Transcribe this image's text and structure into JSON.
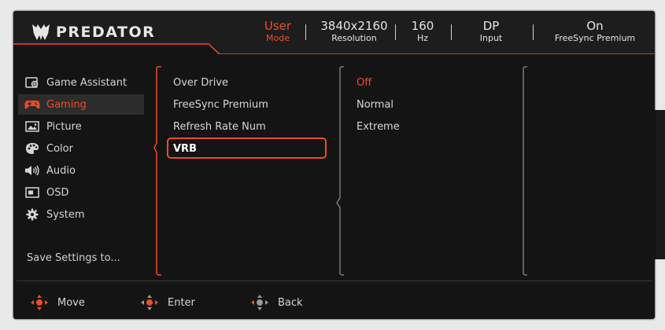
{
  "brand": {
    "name": "PREDATOR"
  },
  "status_bar": [
    {
      "value": "User",
      "label": "Mode"
    },
    {
      "value": "3840x2160",
      "label": "Resolution"
    },
    {
      "value": "160",
      "label": "Hz"
    },
    {
      "value": "DP",
      "label": "Input"
    },
    {
      "value": "On",
      "label": "FreeSync Premium"
    }
  ],
  "menu": {
    "items": [
      {
        "label": "Game Assistant",
        "icon": "game-assistant-icon"
      },
      {
        "label": "Gaming",
        "icon": "gamepad-icon",
        "active": true
      },
      {
        "label": "Picture",
        "icon": "picture-icon"
      },
      {
        "label": "Color",
        "icon": "palette-icon"
      },
      {
        "label": "Audio",
        "icon": "speaker-icon"
      },
      {
        "label": "OSD",
        "icon": "osd-icon"
      },
      {
        "label": "System",
        "icon": "gear-icon"
      }
    ],
    "save_label": "Save Settings to..."
  },
  "gaming_options": {
    "items": [
      "Over Drive",
      "FreeSync Premium",
      "Refresh Rate Num",
      "VRB"
    ],
    "selected": "VRB"
  },
  "values": {
    "items": [
      "Off",
      "Normal",
      "Extreme"
    ],
    "current": "Off"
  },
  "footer": {
    "move": "Move",
    "enter": "Enter",
    "back": "Back"
  },
  "colors": {
    "accent": "#f04a2a",
    "background": "#141414",
    "text": "#d6d6d6"
  }
}
